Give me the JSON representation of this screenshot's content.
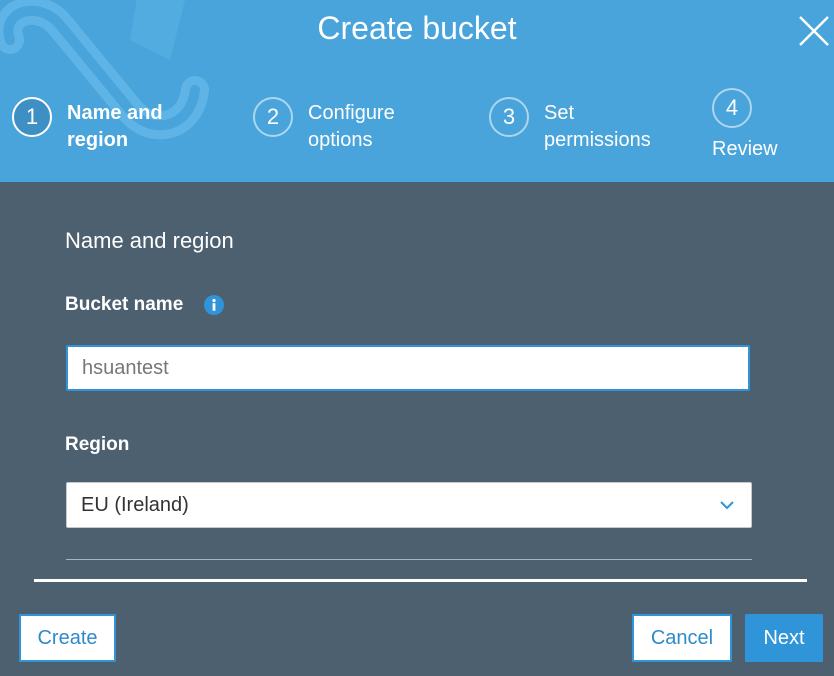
{
  "dialog": {
    "title": "Create bucket"
  },
  "steps": [
    {
      "number": "1",
      "label_line1": "Name and",
      "label_line2": "region",
      "active": true
    },
    {
      "number": "2",
      "label_line1": "Configure",
      "label_line2": "options",
      "active": false
    },
    {
      "number": "3",
      "label_line1": "Set",
      "label_line2": "permissions",
      "active": false
    },
    {
      "number": "4",
      "label_line1": "Review",
      "label_line2": "",
      "active": false
    }
  ],
  "form": {
    "section_title": "Name and region",
    "bucket_name_label": "Bucket name",
    "bucket_name_value": "hsuantest",
    "region_label": "Region",
    "region_value": "EU (Ireland)"
  },
  "footer": {
    "create_label": "Create",
    "cancel_label": "Cancel",
    "next_label": "Next"
  },
  "colors": {
    "header_bg": "#48a4da",
    "body_bg": "#4c6070",
    "accent": "#2f94d8"
  }
}
